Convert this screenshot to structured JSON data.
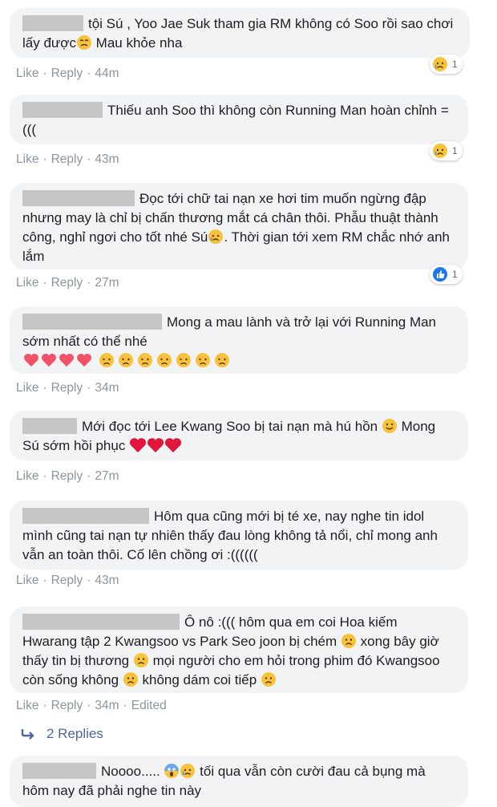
{
  "comments": [
    {
      "text": "tội Sú , Yoo Jae Suk tham gia RM không có Soo rồi sao chơi lấy được",
      "text_end": " Mau khỏe nha",
      "time": "44m",
      "reaction_count": "1"
    },
    {
      "text": "Thiếu anh Soo thì không còn Running Man hoàn chỉnh =(((",
      "time": "43m",
      "reaction_count": "1"
    },
    {
      "text": "Đọc tới chữ tai nạn xe hơi tim muốn ngừng đập nhưng may là chỉ bị chấn thương mắt cá chân thôi. Phẫu thuật thành công, nghỉ ngơi cho tốt nhé Sú",
      "text_end": ". Thời gian tới xem RM chắc nhớ anh lắm",
      "time": "27m",
      "reaction_count": "1"
    },
    {
      "text": "Mong a mau lành và trở lại với Running Man sớm nhất có thể nhé",
      "time": "34m"
    },
    {
      "text": "Mới đọc tới Lee Kwang Soo bị tai nạn mà hú hồn",
      "text_end": " Mong Sú sớm hồi phục",
      "time": "27m"
    },
    {
      "text": "Hôm qua cũng mới bị té xe, nay nghe tin idol mình cũng tai nạn tự nhiên thấy đau lòng không tả nổi, chỉ mong anh vẫn an toàn thôi. Cố lên chồng ơi :((((((",
      "time": "43m"
    },
    {
      "text": "Ô nô :((( hôm qua em coi Hoa kiếm Hwarang tập 2 Kwangsoo vs Park Seo joon bị chém",
      "text_mid": " xong bây giờ thấy tin bị thương",
      "text_mid2": " mọi người cho em hỏi trong phim đó Kwangsoo còn sống không",
      "text_mid3": " không dám coi tiếp",
      "time": "34m",
      "edited": "Edited"
    },
    {
      "text": "Noooo.....",
      "text_end": " tối qua vẫn còn cười đau cả bụng mà hôm nay đã phải nghe tin này"
    }
  ],
  "actions": {
    "like": "Like",
    "reply": "Reply",
    "dot": "·"
  },
  "replies_label": "2 Replies",
  "colors": {
    "bubble": "#f2f3f5",
    "link": "#8d949e",
    "replies": "#4b67a1",
    "redact": "#c5c6c8"
  }
}
